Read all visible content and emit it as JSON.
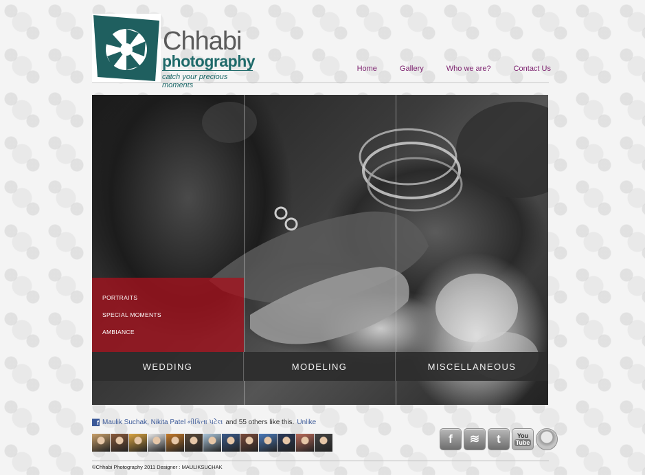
{
  "brand": {
    "title": "Chhabi",
    "subtitle": "photography",
    "tagline": "catch your precious moments",
    "colors": {
      "teal": "#1f6a6a",
      "grey": "#5a5a5a"
    }
  },
  "nav": {
    "items": [
      {
        "label": "Home"
      },
      {
        "label": "Gallery"
      },
      {
        "label": "Who we are?"
      },
      {
        "label": "Contact Us"
      }
    ],
    "color": "#7b1f6d"
  },
  "hero": {
    "submenu": [
      "PORTRAITS",
      "SPECIAL MOMENTS",
      "AMBIANCE"
    ],
    "categories": [
      "WEDDING",
      "MODELING",
      "MISCELLANEOUS"
    ],
    "accent": "#a5121e"
  },
  "like": {
    "names": "Maulik Suchak, Nikita Patel નીકિતા પટેલ",
    "suffix": "and 55 others like this.",
    "action": "Unlike"
  },
  "faces_count": 13,
  "social": [
    {
      "icon": "facebook-icon",
      "glyph": "f"
    },
    {
      "icon": "rss-icon",
      "glyph": "≋"
    },
    {
      "icon": "twitter-icon",
      "glyph": "t"
    },
    {
      "icon": "youtube-icon",
      "line1": "You",
      "line2": "Tube"
    },
    {
      "icon": "circle-icon",
      "glyph": ""
    }
  ],
  "footer": {
    "text": "©Chhabi Photography 2011 Designer : MAULIKSUCHAK"
  }
}
